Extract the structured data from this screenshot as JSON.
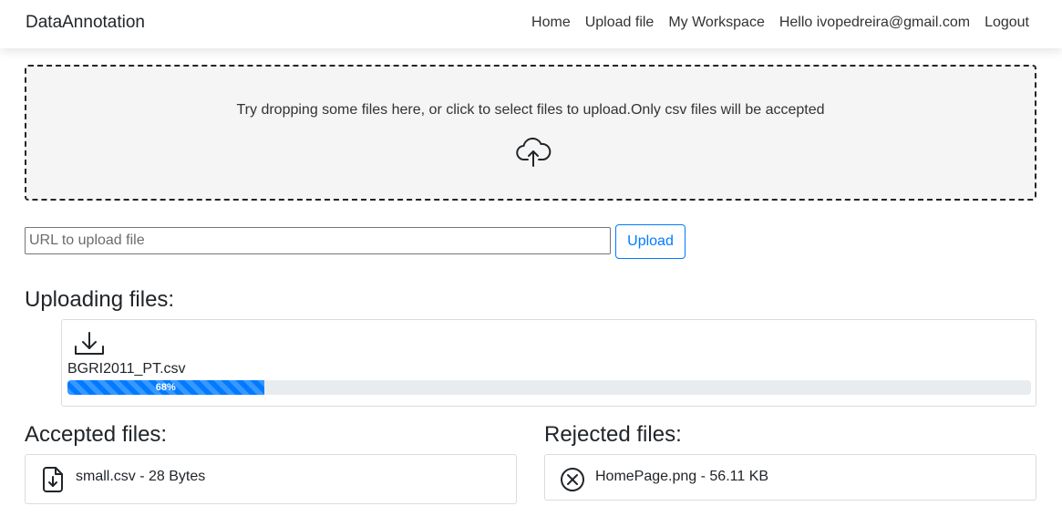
{
  "navbar": {
    "brand": "DataAnnotation",
    "links": [
      "Home",
      "Upload file",
      "My Workspace",
      "Hello ivopedreira@gmail.com",
      "Logout"
    ]
  },
  "dropzone": {
    "text": "Try dropping some files here, or click to select files to upload.Only csv files will be accepted",
    "icon": "cloud-upload-icon"
  },
  "url_upload": {
    "placeholder": "URL to upload file",
    "value": "",
    "button_label": "Upload"
  },
  "uploading": {
    "heading": "Uploading files:",
    "files": [
      {
        "name": "BGRI2011_PT.csv",
        "progress_percent": 68,
        "progress_label": "68%",
        "icon": "download-icon"
      }
    ]
  },
  "accepted": {
    "heading": "Accepted files:",
    "files": [
      {
        "label": "small.csv - 28 Bytes",
        "icon": "file-download-icon"
      }
    ]
  },
  "rejected": {
    "heading": "Rejected files:",
    "files": [
      {
        "label": "HomePage.png - 56.11 KB",
        "icon": "circle-x-icon"
      }
    ]
  },
  "colors": {
    "primary": "#007bff",
    "progress_track": "#e9ecef",
    "dropzone_bg": "#f5f5f5"
  }
}
